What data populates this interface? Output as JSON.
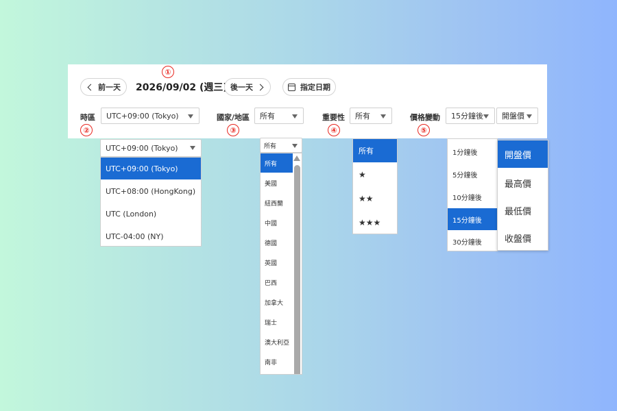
{
  "nav": {
    "prev_label": "前一天",
    "date": "2026/09/02 (週三)",
    "next_label": "後一天",
    "pick_date_label": "指定日期"
  },
  "filters": {
    "timezone": {
      "label": "時區",
      "value": "UTC+09:00 (Tokyo)"
    },
    "country": {
      "label": "國家/地區",
      "value": "所有"
    },
    "importance": {
      "label": "重要性",
      "value": "所有"
    },
    "price_change": {
      "label": "價格變動",
      "interval_value": "15分鐘後",
      "price_value": "開盤價"
    }
  },
  "markers": [
    "①",
    "②",
    "③",
    "④",
    "⑤"
  ],
  "timezone_dropdown": {
    "value": "UTC+09:00 (Tokyo)",
    "options": [
      "UTC+09:00 (Tokyo)",
      "UTC+08:00 (HongKong)",
      "UTC (London)",
      "UTC-04:00 (NY)"
    ],
    "selected": "UTC+09:00 (Tokyo)"
  },
  "country_dropdown": {
    "value": "所有",
    "options": [
      "所有",
      "美國",
      "紐西蘭",
      "中國",
      "德國",
      "英國",
      "巴西",
      "加拿大",
      "瑞士",
      "澳大利亞",
      "南非"
    ],
    "selected": "所有"
  },
  "importance_dropdown": {
    "options": [
      "所有",
      "★",
      "★★",
      "★★★"
    ],
    "selected": "所有"
  },
  "interval_dropdown": {
    "options": [
      "1分鐘後",
      "5分鐘後",
      "10分鐘後",
      "15分鐘後",
      "30分鐘後"
    ],
    "selected": "15分鐘後"
  },
  "price_dropdown": {
    "options": [
      "開盤價",
      "最高價",
      "最低價",
      "收盤價"
    ],
    "selected": "開盤價"
  },
  "colors": {
    "accent": "#1a6bd3",
    "marker": "#e8261f"
  }
}
